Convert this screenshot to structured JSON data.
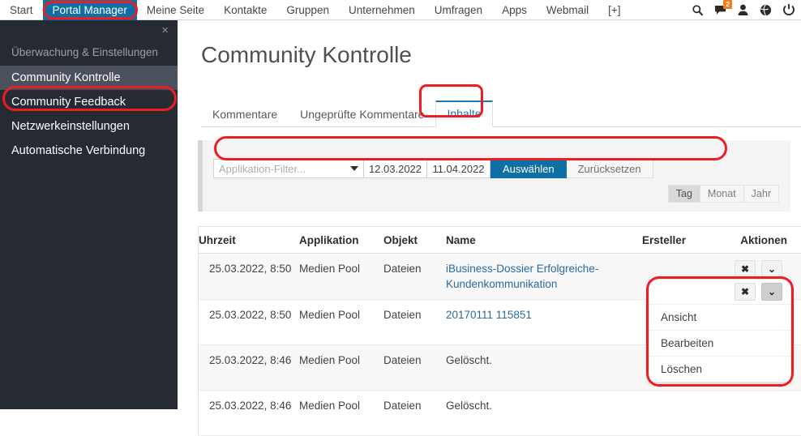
{
  "topnav": {
    "items": [
      {
        "label": "Start",
        "active": false
      },
      {
        "label": "Portal Manager",
        "active": true
      },
      {
        "label": "Meine Seite",
        "active": false
      },
      {
        "label": "Kontakte",
        "active": false
      },
      {
        "label": "Gruppen",
        "active": false
      },
      {
        "label": "Unternehmen",
        "active": false
      },
      {
        "label": "Umfragen",
        "active": false
      },
      {
        "label": "Apps",
        "active": false
      },
      {
        "label": "Webmail",
        "active": false
      },
      {
        "label": "[+]",
        "active": false
      }
    ],
    "icons": [
      {
        "name": "search-icon"
      },
      {
        "name": "messages-icon",
        "badge": "2"
      },
      {
        "name": "user-icon"
      },
      {
        "name": "globe-icon"
      },
      {
        "name": "power-icon"
      }
    ],
    "active_tab_color": "#0d6fa3",
    "badge_color": "#f47b20"
  },
  "sidebar": {
    "close_label": "×",
    "heading": "Überwachung & Einstellungen",
    "items": [
      {
        "label": "Community Kontrolle",
        "active": true
      },
      {
        "label": "Community Feedback",
        "active": false
      },
      {
        "label": "Netzwerkeinstellungen",
        "active": false
      },
      {
        "label": "Automatische Verbindung",
        "active": false
      }
    ],
    "background": "#262b33",
    "active_background": "#4b525e"
  },
  "main": {
    "page_title": "Community Kontrolle",
    "tabs": [
      {
        "label": "Kommentare",
        "active": false
      },
      {
        "label": "Ungeprüfte Kommentare",
        "active": false
      },
      {
        "label": "Inhalte",
        "active": true
      }
    ],
    "active_tab_color": "#1a77b5"
  },
  "filter": {
    "application_placeholder": "Applikation-Filter...",
    "application_value": "",
    "date_from": "12.03.2022",
    "date_to": "11.04.2022",
    "select_label": "Auswählen",
    "reset_label": "Zurücksetzen",
    "granularity": [
      {
        "label": "Tag",
        "active": true
      },
      {
        "label": "Monat",
        "active": false
      },
      {
        "label": "Jahr",
        "active": false
      }
    ]
  },
  "table": {
    "columns": [
      "Uhrzeit",
      "Applikation",
      "Objekt",
      "Name",
      "Ersteller",
      "Aktionen"
    ],
    "rows": [
      {
        "time": "25.03.2022, 8:50",
        "application": "Medien Pool",
        "object": "Dateien",
        "name": "iBusiness-Dossier Erfolgreiche-Kundenkommunikation",
        "name_is_link": true,
        "creator": "",
        "actions": {
          "remove": "✖",
          "menu": "⌄"
        }
      },
      {
        "time": "25.03.2022, 8:50",
        "application": "Medien Pool",
        "object": "Dateien",
        "name": "20170111 115851",
        "name_is_link": true,
        "creator": "",
        "actions": {
          "remove": "✖",
          "menu": "⌄"
        }
      },
      {
        "time": "25.03.2022, 8:46",
        "application": "Medien Pool",
        "object": "Dateien",
        "name": "Gelöscht.",
        "name_is_link": false,
        "creator": "",
        "actions": {
          "remove": "✖",
          "menu": "⌄"
        }
      },
      {
        "time": "25.03.2022, 8:46",
        "application": "Medien Pool",
        "object": "Dateien",
        "name": "Gelöscht.",
        "name_is_link": false,
        "creator": "",
        "actions": {
          "remove": "✖",
          "menu": "⌄"
        }
      }
    ],
    "link_color": "#2b6a9c"
  },
  "row_dropdown": {
    "remove_label": "✖",
    "menu_label": "⌄",
    "items": [
      {
        "label": "Ansicht"
      },
      {
        "label": "Bearbeiten"
      },
      {
        "label": "Löschen"
      }
    ]
  },
  "annotations": {
    "color": "#ee1c23",
    "targets": [
      "portal-manager-tab",
      "community-kontrolle-sidebar-item",
      "inhalte-tab",
      "filter-bar",
      "row-action-dropdown"
    ]
  }
}
